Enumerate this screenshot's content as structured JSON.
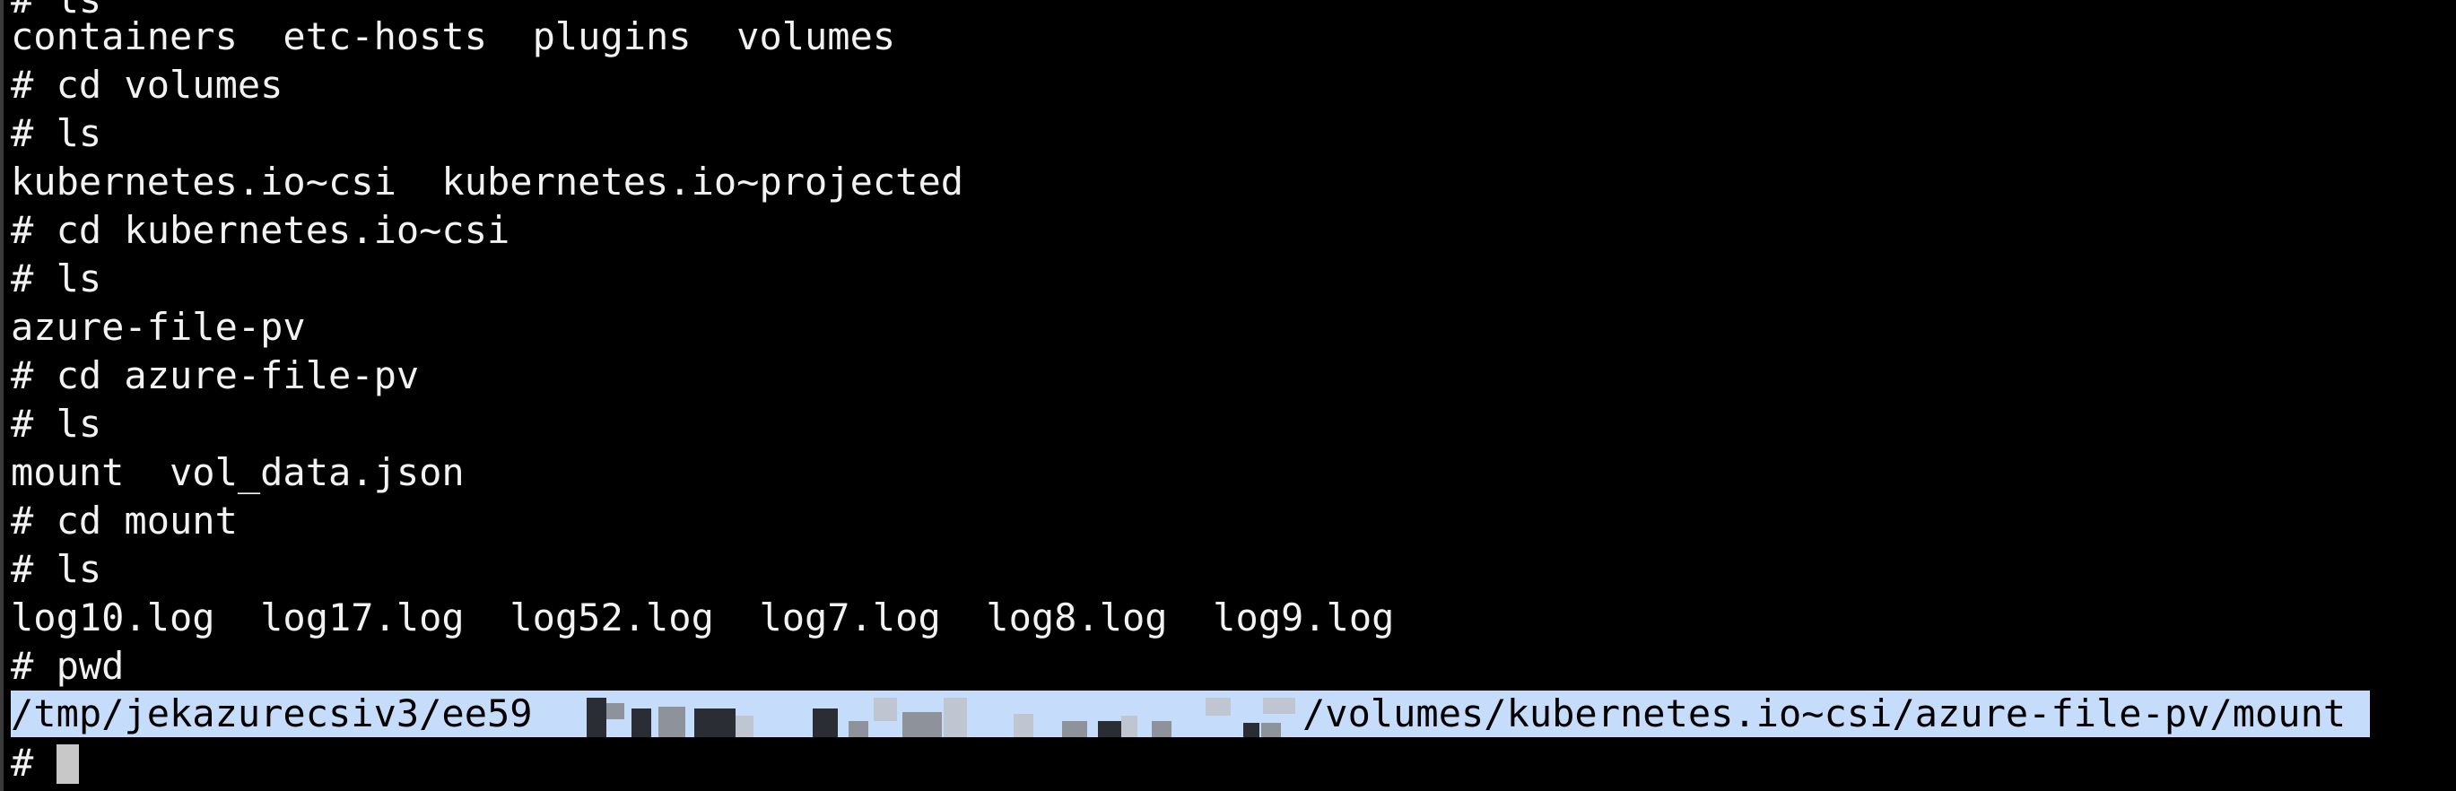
{
  "terminal": {
    "lines": {
      "l0": "# ls",
      "l1": "containers  etc-hosts  plugins  volumes",
      "l2": "# cd volumes",
      "l3": "# ls",
      "l4": "kubernetes.io~csi  kubernetes.io~projected",
      "l5": "# cd kubernetes.io~csi",
      "l6": "# ls",
      "l7": "azure-file-pv",
      "l8": "# cd azure-file-pv",
      "l9": "# ls",
      "l10": "mount  vol_data.json",
      "l11": "# cd mount",
      "l12": "# ls",
      "l13": "log10.log  log17.log  log52.log  log7.log  log8.log  log9.log",
      "l14": "# pwd"
    },
    "selected_path": {
      "prefix": "/tmp/jekazurecsiv3/ee59",
      "suffix": "/volumes/kubernetes.io~csi/azure-file-pv/mount"
    },
    "prompt": "#"
  },
  "colors": {
    "background": "#000000",
    "text": "#f2f2f2",
    "selection": "#c6dcfb"
  }
}
